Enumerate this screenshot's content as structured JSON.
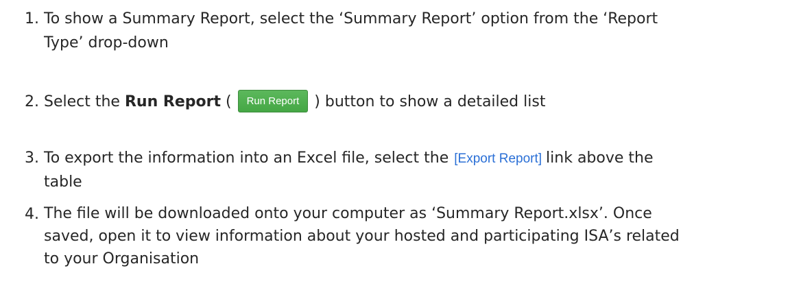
{
  "steps": [
    {
      "number": "1.",
      "line1": "To show a Summary Report, select the ‘Summary Report’ option from the ‘Report",
      "line2": "Type’ drop-down"
    },
    {
      "number": "2.",
      "pre": "Select the ",
      "bold": "Run Report",
      "open_paren": " (",
      "button_label": "Run Report",
      "post": ") button to show a detailed list"
    },
    {
      "number": "3.",
      "pre": "To export the information into an Excel file, select the",
      "link_label": "[Export Report]",
      "post": "link above the",
      "line2": "table"
    },
    {
      "number": "4.",
      "line1": "The file will be downloaded onto your computer as ‘Summary Report.xlsx’. Once",
      "line2": "saved, open it to view information about your hosted and participating ISA’s related",
      "line3": "to your Organisation"
    }
  ],
  "colors": {
    "button_green": "#5cb85c",
    "link_blue": "#2a6fd6",
    "body_text": "#262626"
  }
}
